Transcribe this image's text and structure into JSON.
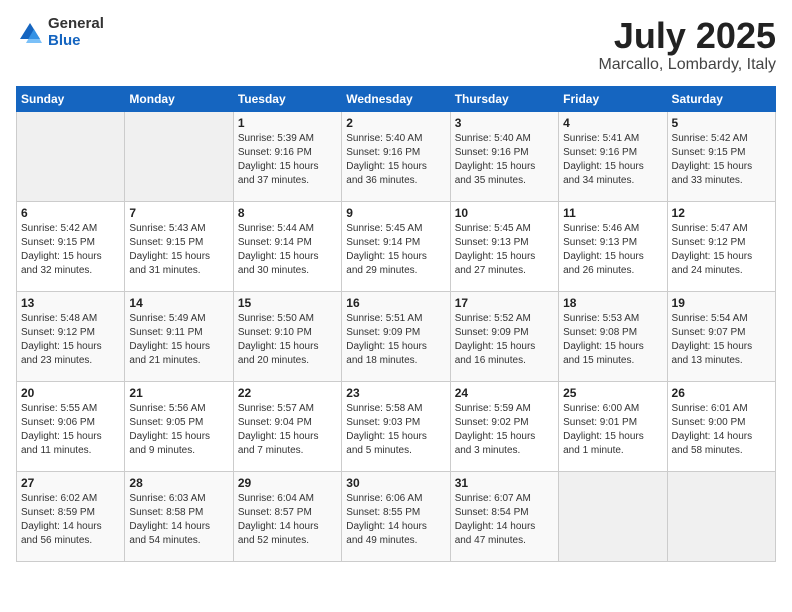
{
  "header": {
    "logo_general": "General",
    "logo_blue": "Blue",
    "month_title": "July 2025",
    "location": "Marcallo, Lombardy, Italy"
  },
  "days_of_week": [
    "Sunday",
    "Monday",
    "Tuesday",
    "Wednesday",
    "Thursday",
    "Friday",
    "Saturday"
  ],
  "weeks": [
    [
      {
        "day": "",
        "info": ""
      },
      {
        "day": "",
        "info": ""
      },
      {
        "day": "1",
        "info": "Sunrise: 5:39 AM\nSunset: 9:16 PM\nDaylight: 15 hours\nand 37 minutes."
      },
      {
        "day": "2",
        "info": "Sunrise: 5:40 AM\nSunset: 9:16 PM\nDaylight: 15 hours\nand 36 minutes."
      },
      {
        "day": "3",
        "info": "Sunrise: 5:40 AM\nSunset: 9:16 PM\nDaylight: 15 hours\nand 35 minutes."
      },
      {
        "day": "4",
        "info": "Sunrise: 5:41 AM\nSunset: 9:16 PM\nDaylight: 15 hours\nand 34 minutes."
      },
      {
        "day": "5",
        "info": "Sunrise: 5:42 AM\nSunset: 9:15 PM\nDaylight: 15 hours\nand 33 minutes."
      }
    ],
    [
      {
        "day": "6",
        "info": "Sunrise: 5:42 AM\nSunset: 9:15 PM\nDaylight: 15 hours\nand 32 minutes."
      },
      {
        "day": "7",
        "info": "Sunrise: 5:43 AM\nSunset: 9:15 PM\nDaylight: 15 hours\nand 31 minutes."
      },
      {
        "day": "8",
        "info": "Sunrise: 5:44 AM\nSunset: 9:14 PM\nDaylight: 15 hours\nand 30 minutes."
      },
      {
        "day": "9",
        "info": "Sunrise: 5:45 AM\nSunset: 9:14 PM\nDaylight: 15 hours\nand 29 minutes."
      },
      {
        "day": "10",
        "info": "Sunrise: 5:45 AM\nSunset: 9:13 PM\nDaylight: 15 hours\nand 27 minutes."
      },
      {
        "day": "11",
        "info": "Sunrise: 5:46 AM\nSunset: 9:13 PM\nDaylight: 15 hours\nand 26 minutes."
      },
      {
        "day": "12",
        "info": "Sunrise: 5:47 AM\nSunset: 9:12 PM\nDaylight: 15 hours\nand 24 minutes."
      }
    ],
    [
      {
        "day": "13",
        "info": "Sunrise: 5:48 AM\nSunset: 9:12 PM\nDaylight: 15 hours\nand 23 minutes."
      },
      {
        "day": "14",
        "info": "Sunrise: 5:49 AM\nSunset: 9:11 PM\nDaylight: 15 hours\nand 21 minutes."
      },
      {
        "day": "15",
        "info": "Sunrise: 5:50 AM\nSunset: 9:10 PM\nDaylight: 15 hours\nand 20 minutes."
      },
      {
        "day": "16",
        "info": "Sunrise: 5:51 AM\nSunset: 9:09 PM\nDaylight: 15 hours\nand 18 minutes."
      },
      {
        "day": "17",
        "info": "Sunrise: 5:52 AM\nSunset: 9:09 PM\nDaylight: 15 hours\nand 16 minutes."
      },
      {
        "day": "18",
        "info": "Sunrise: 5:53 AM\nSunset: 9:08 PM\nDaylight: 15 hours\nand 15 minutes."
      },
      {
        "day": "19",
        "info": "Sunrise: 5:54 AM\nSunset: 9:07 PM\nDaylight: 15 hours\nand 13 minutes."
      }
    ],
    [
      {
        "day": "20",
        "info": "Sunrise: 5:55 AM\nSunset: 9:06 PM\nDaylight: 15 hours\nand 11 minutes."
      },
      {
        "day": "21",
        "info": "Sunrise: 5:56 AM\nSunset: 9:05 PM\nDaylight: 15 hours\nand 9 minutes."
      },
      {
        "day": "22",
        "info": "Sunrise: 5:57 AM\nSunset: 9:04 PM\nDaylight: 15 hours\nand 7 minutes."
      },
      {
        "day": "23",
        "info": "Sunrise: 5:58 AM\nSunset: 9:03 PM\nDaylight: 15 hours\nand 5 minutes."
      },
      {
        "day": "24",
        "info": "Sunrise: 5:59 AM\nSunset: 9:02 PM\nDaylight: 15 hours\nand 3 minutes."
      },
      {
        "day": "25",
        "info": "Sunrise: 6:00 AM\nSunset: 9:01 PM\nDaylight: 15 hours\nand 1 minute."
      },
      {
        "day": "26",
        "info": "Sunrise: 6:01 AM\nSunset: 9:00 PM\nDaylight: 14 hours\nand 58 minutes."
      }
    ],
    [
      {
        "day": "27",
        "info": "Sunrise: 6:02 AM\nSunset: 8:59 PM\nDaylight: 14 hours\nand 56 minutes."
      },
      {
        "day": "28",
        "info": "Sunrise: 6:03 AM\nSunset: 8:58 PM\nDaylight: 14 hours\nand 54 minutes."
      },
      {
        "day": "29",
        "info": "Sunrise: 6:04 AM\nSunset: 8:57 PM\nDaylight: 14 hours\nand 52 minutes."
      },
      {
        "day": "30",
        "info": "Sunrise: 6:06 AM\nSunset: 8:55 PM\nDaylight: 14 hours\nand 49 minutes."
      },
      {
        "day": "31",
        "info": "Sunrise: 6:07 AM\nSunset: 8:54 PM\nDaylight: 14 hours\nand 47 minutes."
      },
      {
        "day": "",
        "info": ""
      },
      {
        "day": "",
        "info": ""
      }
    ]
  ]
}
